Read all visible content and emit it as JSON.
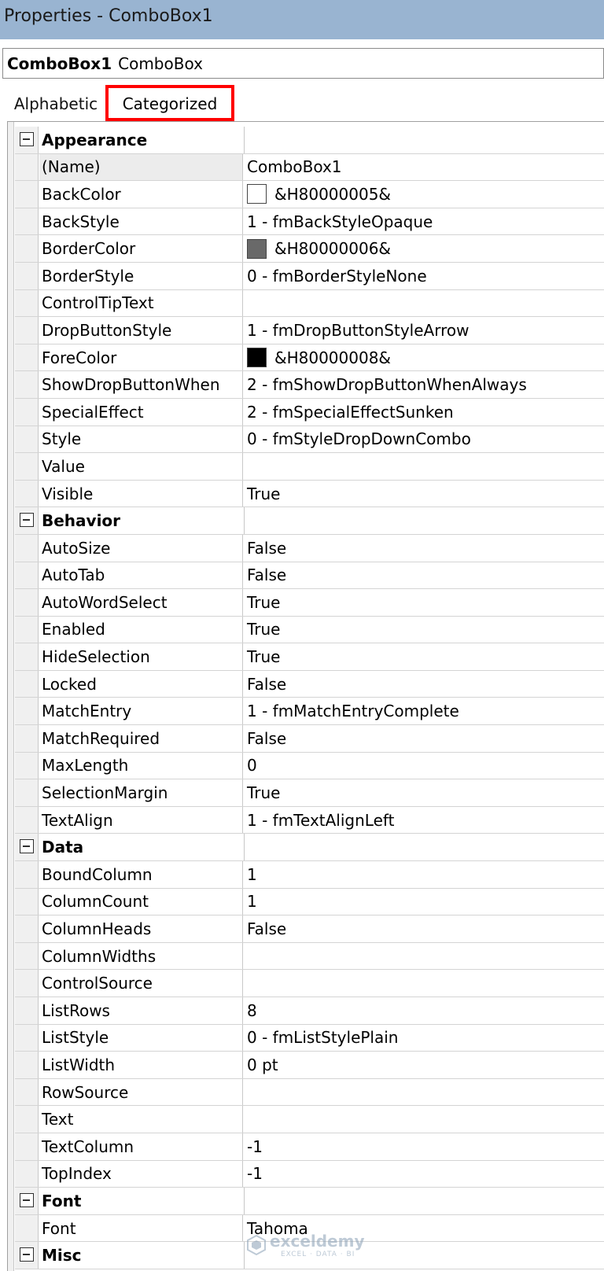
{
  "window": {
    "title": "Properties - ComboBox1"
  },
  "object_selector": {
    "name": "ComboBox1",
    "type": "ComboBox"
  },
  "tabs": [
    {
      "label": "Alphabetic",
      "selected": false
    },
    {
      "label": "Categorized",
      "selected": true
    }
  ],
  "categories": [
    {
      "name": "Appearance",
      "properties": [
        {
          "name": "(Name)",
          "value": "ComboBox1",
          "selected": true
        },
        {
          "name": "BackColor",
          "value": "&H80000005&",
          "swatch": "#ffffff"
        },
        {
          "name": "BackStyle",
          "value": "1 - fmBackStyleOpaque"
        },
        {
          "name": "BorderColor",
          "value": "&H80000006&",
          "swatch": "#696969"
        },
        {
          "name": "BorderStyle",
          "value": "0 - fmBorderStyleNone"
        },
        {
          "name": "ControlTipText",
          "value": ""
        },
        {
          "name": "DropButtonStyle",
          "value": "1 - fmDropButtonStyleArrow"
        },
        {
          "name": "ForeColor",
          "value": "&H80000008&",
          "swatch": "#000000"
        },
        {
          "name": "ShowDropButtonWhen",
          "value": "2 - fmShowDropButtonWhenAlways"
        },
        {
          "name": "SpecialEffect",
          "value": "2 - fmSpecialEffectSunken"
        },
        {
          "name": "Style",
          "value": "0 - fmStyleDropDownCombo"
        },
        {
          "name": "Value",
          "value": ""
        },
        {
          "name": "Visible",
          "value": "True"
        }
      ]
    },
    {
      "name": "Behavior",
      "properties": [
        {
          "name": "AutoSize",
          "value": "False"
        },
        {
          "name": "AutoTab",
          "value": "False"
        },
        {
          "name": "AutoWordSelect",
          "value": "True"
        },
        {
          "name": "Enabled",
          "value": "True"
        },
        {
          "name": "HideSelection",
          "value": "True"
        },
        {
          "name": "Locked",
          "value": "False"
        },
        {
          "name": "MatchEntry",
          "value": "1 - fmMatchEntryComplete"
        },
        {
          "name": "MatchRequired",
          "value": "False"
        },
        {
          "name": "MaxLength",
          "value": "0"
        },
        {
          "name": "SelectionMargin",
          "value": "True"
        },
        {
          "name": "TextAlign",
          "value": "1 - fmTextAlignLeft"
        }
      ]
    },
    {
      "name": "Data",
      "properties": [
        {
          "name": "BoundColumn",
          "value": "1"
        },
        {
          "name": "ColumnCount",
          "value": "1"
        },
        {
          "name": "ColumnHeads",
          "value": "False"
        },
        {
          "name": "ColumnWidths",
          "value": ""
        },
        {
          "name": "ControlSource",
          "value": ""
        },
        {
          "name": "ListRows",
          "value": "8"
        },
        {
          "name": "ListStyle",
          "value": "0 - fmListStylePlain"
        },
        {
          "name": "ListWidth",
          "value": "0 pt"
        },
        {
          "name": "RowSource",
          "value": ""
        },
        {
          "name": "Text",
          "value": ""
        },
        {
          "name": "TextColumn",
          "value": "-1"
        },
        {
          "name": "TopIndex",
          "value": "-1"
        }
      ]
    },
    {
      "name": "Font",
      "properties": [
        {
          "name": "Font",
          "value": "Tahoma"
        }
      ]
    },
    {
      "name": "Misc",
      "properties": []
    }
  ],
  "watermark": {
    "brand": "exceldemy",
    "tagline": "EXCEL · DATA · BI"
  },
  "colors": {
    "title_bar": "#99b4d1",
    "highlight_border": "#ff0000"
  }
}
